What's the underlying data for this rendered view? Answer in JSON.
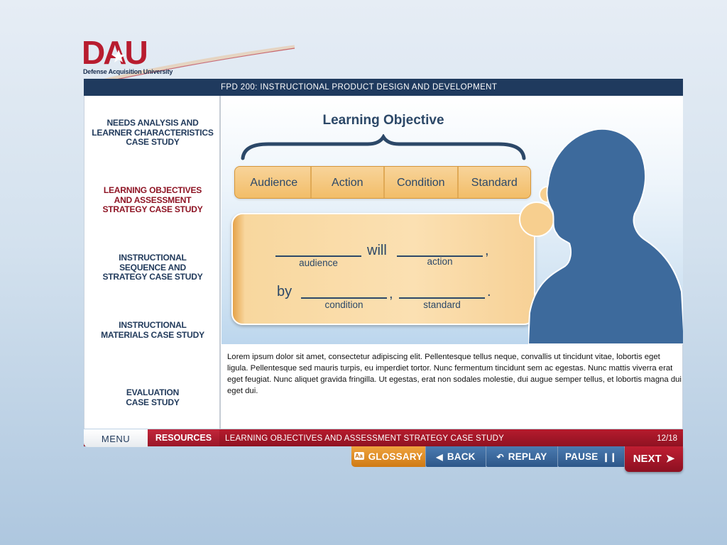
{
  "logo": {
    "mark": "DAU",
    "subtitle": "Defense Acquisition University"
  },
  "course": {
    "title": "FPD 200: INSTRUCTIONAL PRODUCT DESIGN AND DEVELOPMENT"
  },
  "menu": {
    "items": [
      {
        "label": "NEEDS ANALYSIS AND\nLEARNER CHARACTERISTICS\nCASE STUDY",
        "active": false
      },
      {
        "label": "LEARNING OBJECTIVES\nAND ASSESSMENT\nSTRATEGY CASE STUDY",
        "active": true
      },
      {
        "label": "INSTRUCTIONAL\nSEQUENCE AND\nSTRATEGY CASE STUDY",
        "active": false
      },
      {
        "label": "INSTRUCTIONAL\nMATERIALS CASE STUDY",
        "active": false
      },
      {
        "label": "EVALUATION\nCASE STUDY",
        "active": false
      }
    ]
  },
  "stage": {
    "title": "Learning Objective",
    "tabs": [
      "Audience",
      "Action",
      "Condition",
      "Standard"
    ],
    "formula": {
      "will": "will",
      "by": "by",
      "comma": ",",
      "period": ".",
      "labels": {
        "audience": "audience",
        "action": "action",
        "condition": "condition",
        "standard": "standard"
      }
    }
  },
  "body_text": "Lorem ipsum dolor sit amet, consectetur adipiscing elit. Pellentesque tellus neque, convallis ut tincidunt vitae, lobortis eget ligula. Pellentesque sed mauris turpis, eu imperdiet tortor. Nunc fermentum tincidunt sem ac egestas. Nunc mattis viverra erat eget feugiat. Nunc aliquet gravida fringilla. Ut egestas, erat non sodales molestie, dui augue semper tellus, et lobortis magna dui eget dui.",
  "footer": {
    "menu_label": "MENU",
    "resources_label": "RESOURCES",
    "section_title": "LEARNING OBJECTIVES AND ASSESSMENT STRATEGY CASE STUDY",
    "page_count": "12/18"
  },
  "controls": {
    "glossary_icon": "Aa",
    "glossary": "GLOSSARY",
    "back": "BACK",
    "replay": "REPLAY",
    "pause": "PAUSE",
    "next": "NEXT"
  },
  "icons": {
    "back": "chevron-left-icon",
    "replay": "replay-icon",
    "pause": "pause-icon",
    "next": "chevron-right-icon",
    "glossary": "glossary-icon"
  },
  "colors": {
    "navy": "#1f3a5e",
    "brand_red": "#a3182b",
    "accent_orange": "#f2bd68",
    "control_blue": "#3b68a0",
    "silhouette_blue": "#3d6a9c"
  }
}
